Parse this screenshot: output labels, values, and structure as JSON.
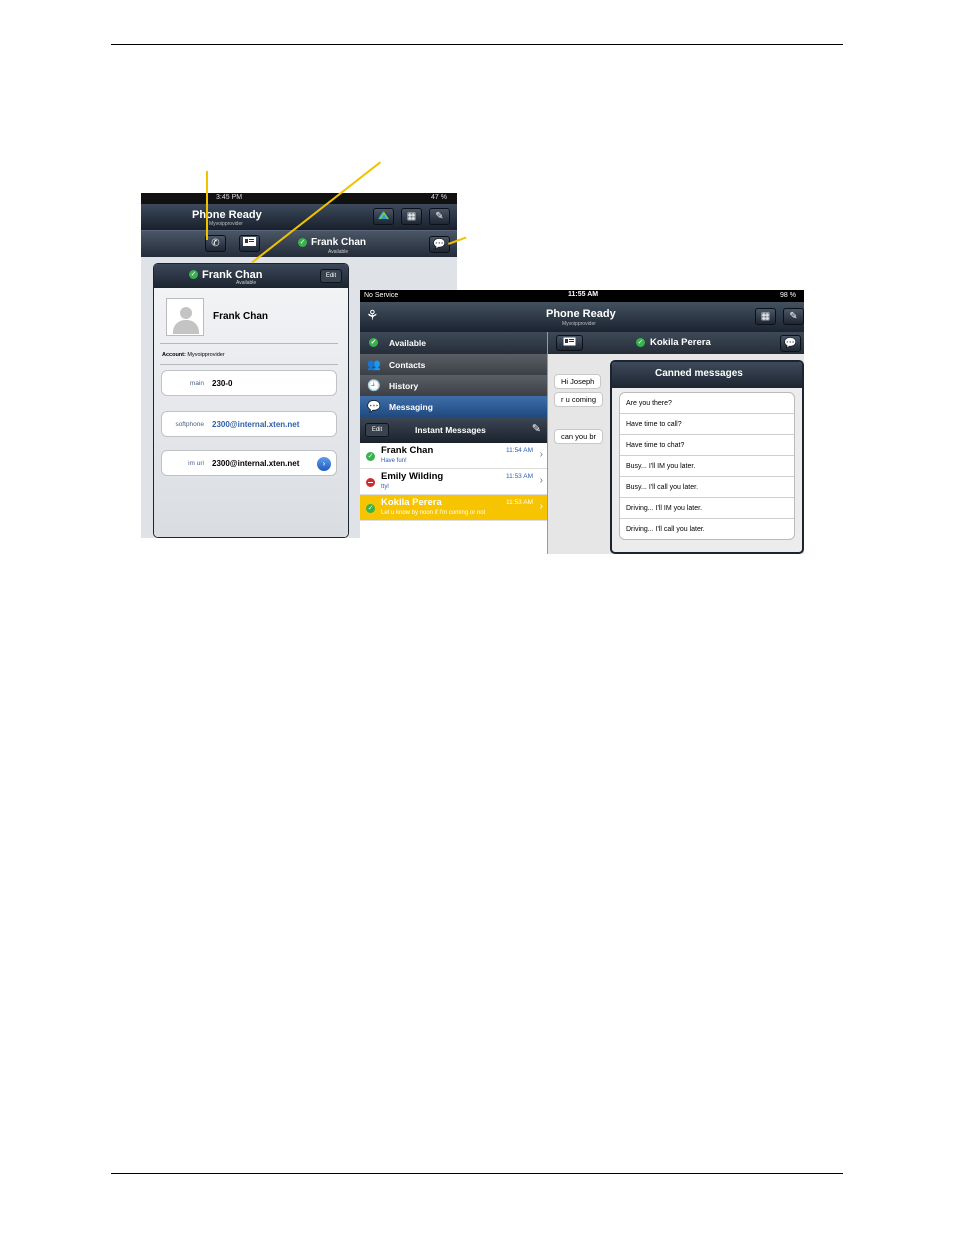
{
  "left_screen": {
    "status_time": "3:45 PM",
    "status_battery": "47 %",
    "app_title": "Phone Ready",
    "app_subtitle": "Myvoipprovider",
    "contact_name": "Frank Chan",
    "contact_status": "Available",
    "popover": {
      "header_name": "Frank Chan",
      "header_status": "Available",
      "edit_label": "Edit",
      "card_name": "Frank Chan",
      "account_label": "Account:",
      "account_value": "Myvoipprovider",
      "fields": [
        {
          "label": "main",
          "value": "230-0"
        },
        {
          "label": "softphone",
          "value": "2300@internal.xten.net"
        },
        {
          "label": "im uri",
          "value": "2300@internal.xten.net"
        }
      ]
    }
  },
  "right_screen": {
    "status_carrier": "No Service",
    "status_time": "11:55 AM",
    "status_battery": "98 %",
    "app_title": "Phone Ready",
    "app_subtitle": "Myvoipprovider",
    "presence_label": "Available",
    "nav": {
      "contacts": "Contacts",
      "history": "History",
      "messaging": "Messaging"
    },
    "im_bar": {
      "edit_label": "Edit",
      "title": "Instant Messages"
    },
    "messages": [
      {
        "name": "Frank Chan",
        "time": "11:54 AM",
        "preview": "Have fun!",
        "status": "available"
      },
      {
        "name": "Emily Wilding",
        "time": "11:53 AM",
        "preview": "ttyl",
        "status": "busy"
      },
      {
        "name": "Kokila Perera",
        "time": "11:53 AM",
        "preview": "Let u know by noon if I'm coming or not",
        "status": "available"
      }
    ],
    "chat_contact": "Kokila Perera",
    "chat_bubbles": [
      "Hi Joseph",
      "r u coming",
      "can you br"
    ],
    "canned": {
      "title": "Canned messages",
      "items": [
        "Are you there?",
        "Have time to call?",
        "Have time to chat?",
        "Busy... I'll IM you later.",
        "Busy... I'll call you later.",
        "Driving... I'll IM you later.",
        "Driving... I'll call you later."
      ]
    }
  },
  "colors": {
    "callout": "#f2c200",
    "selected_row": "#f6c400",
    "available": "#37b24d",
    "busy": "#d22d2d",
    "link": "#2e5fa8"
  }
}
